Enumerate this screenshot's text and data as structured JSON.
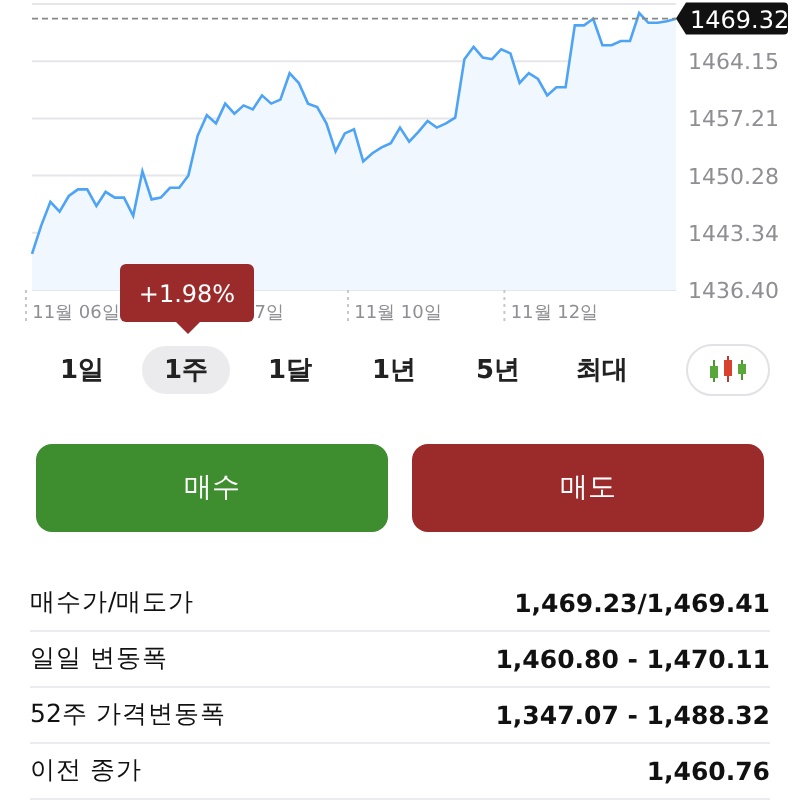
{
  "chart": {
    "change_tooltip": "+1.98%",
    "chart_data": {
      "type": "area",
      "grid": true,
      "ref_lines": [
        {
          "axis": "y",
          "value": 1469.32,
          "label": "1469.32"
        }
      ],
      "ylim": [
        1436.4,
        1471.09
      ],
      "yticks": [
        {
          "value": 1464.15,
          "label": "1464.15"
        },
        {
          "value": 1457.21,
          "label": "1457.21"
        },
        {
          "value": 1450.28,
          "label": "1450.28"
        },
        {
          "value": 1443.34,
          "label": "1443.34"
        },
        {
          "value": 1436.4,
          "label": "1436.40"
        }
      ],
      "categories": [
        null,
        null,
        null,
        null,
        null,
        "11월 06일",
        null,
        null,
        null,
        null,
        null,
        null,
        null,
        null,
        null,
        null,
        null,
        null,
        null,
        null,
        null,
        null,
        null,
        null,
        null,
        null,
        "7일",
        null,
        null,
        null,
        null,
        null,
        null,
        null,
        null,
        null,
        null,
        null,
        null,
        null,
        "11월 10일",
        null,
        null,
        null,
        null,
        null,
        null,
        null,
        null,
        null,
        null,
        null,
        null,
        null,
        null,
        null,
        null,
        "11월 12일",
        null,
        null,
        null,
        null,
        null,
        null,
        null,
        null,
        null,
        null,
        null,
        null,
        null
      ],
      "series": [
        {
          "color": "#4da3f5",
          "values": [
            1440.8,
            1444.2,
            1447.1,
            1445.9,
            1447.8,
            1448.6,
            1448.6,
            1446.6,
            1448.3,
            1447.6,
            1447.6,
            1445.4,
            1450.8,
            1447.4,
            1447.6,
            1448.8,
            1448.8,
            1450.3,
            1455.1,
            1457.6,
            1456.6,
            1459.0,
            1457.8,
            1458.8,
            1458.3,
            1460.0,
            1459.0,
            1459.5,
            1462.7,
            1461.5,
            1459.0,
            1458.6,
            1456.6,
            1453.2,
            1455.4,
            1455.9,
            1452.0,
            1453.0,
            1453.7,
            1454.2,
            1456.1,
            1454.4,
            1455.6,
            1456.9,
            1456.1,
            1456.6,
            1457.3,
            1464.4,
            1465.9,
            1464.6,
            1464.4,
            1465.6,
            1465.1,
            1461.5,
            1462.7,
            1462.0,
            1460.0,
            1461.0,
            1461.0,
            1468.5,
            1468.5,
            1469.3,
            1466.1,
            1466.1,
            1466.6,
            1466.6,
            1470.0,
            1468.8,
            1468.8,
            1469.0,
            1469.3
          ]
        }
      ]
    }
  },
  "ranges": [
    {
      "label": "1일",
      "selected": false
    },
    {
      "label": "1주",
      "selected": true
    },
    {
      "label": "1달",
      "selected": false
    },
    {
      "label": "1년",
      "selected": false
    },
    {
      "label": "5년",
      "selected": false
    },
    {
      "label": "최대",
      "selected": false
    }
  ],
  "actions": [
    {
      "label": "매수",
      "kind": "buy"
    },
    {
      "label": "매도",
      "kind": "sell"
    }
  ],
  "stats": [
    {
      "label": "매수가/매도가",
      "value": "1,469.23/1,469.41"
    },
    {
      "label": "일일 변동폭",
      "value": "1,460.80 - 1,470.11"
    },
    {
      "label": "52주 가격변동폭",
      "value": "1,347.07 - 1,488.32"
    },
    {
      "label": "이전 종가",
      "value": "1,460.76"
    }
  ]
}
